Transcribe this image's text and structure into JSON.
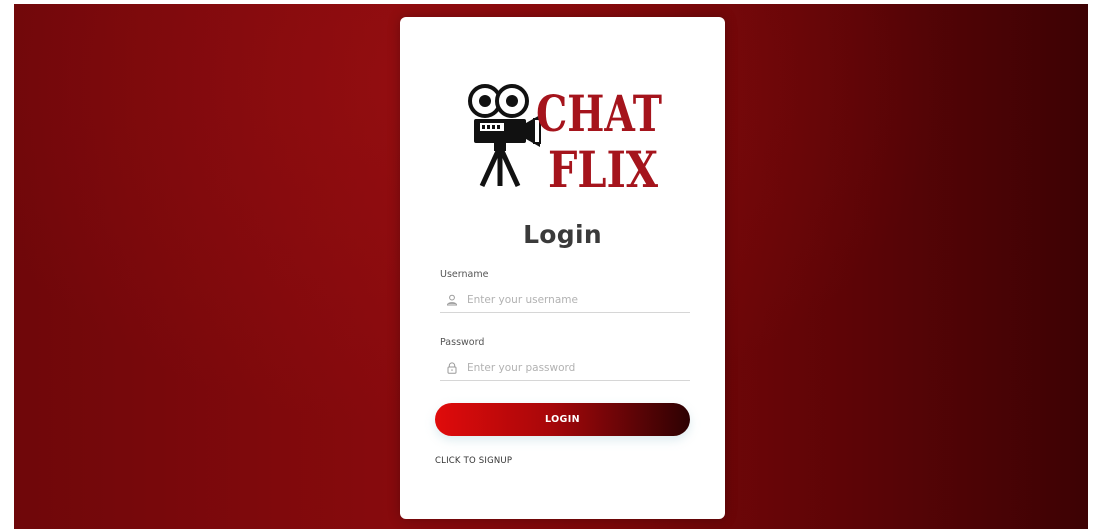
{
  "logo": {
    "line1": "CHAT",
    "line2": "FLIX",
    "icon": "movie-camera-icon",
    "brand_color": "#a5141c"
  },
  "login": {
    "title": "Login",
    "username": {
      "label": "Username",
      "placeholder": "Enter your username",
      "value": "",
      "icon": "user-icon"
    },
    "password": {
      "label": "Password",
      "placeholder": "Enter your password",
      "value": "",
      "icon": "lock-icon"
    },
    "button_label": "LOGIN",
    "signup_link": "CLICK TO SIGNUP"
  },
  "colors": {
    "background_red": "#870a0d",
    "button_start": "#e00b0b",
    "button_end": "#2d0102",
    "card": "#ffffff"
  }
}
